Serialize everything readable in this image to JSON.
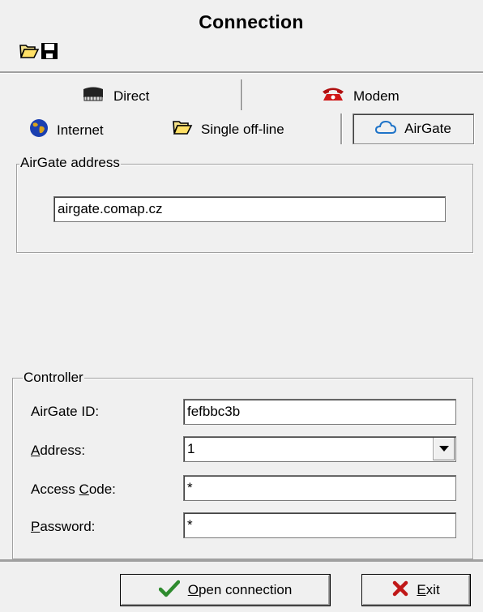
{
  "window": {
    "title": "Connection"
  },
  "toolbar": {
    "open_icon": "folder-open-icon",
    "save_icon": "floppy-save-icon"
  },
  "tabs": {
    "direct": {
      "label": "Direct",
      "icon": "serial-cable-icon"
    },
    "modem": {
      "label": "Modem",
      "icon": "telephone-icon"
    },
    "internet": {
      "label": "Internet",
      "icon": "globe-icon"
    },
    "single_offline": {
      "label": "Single off-line",
      "icon": "folder-open-icon"
    },
    "airgate": {
      "label": "AirGate",
      "icon": "cloud-icon",
      "active": true
    }
  },
  "airgate_group": {
    "legend": "AirGate address",
    "address_value": "airgate.comap.cz"
  },
  "controller_group": {
    "legend": "Controller",
    "airgate_id": {
      "label": "AirGate ID:",
      "value": "fefbbc3b"
    },
    "address": {
      "label_first": "A",
      "label_rest": "ddress:",
      "value": "1"
    },
    "access_code": {
      "label_pre": "Access ",
      "label_u": "C",
      "label_post": "ode:",
      "value": "*"
    },
    "password": {
      "label_first": "P",
      "label_rest": "assword:",
      "value": "*"
    }
  },
  "buttons": {
    "open_connection": {
      "label_first": "O",
      "label_rest": "pen connection",
      "icon": "checkmark-icon",
      "icon_color": "#2e8b2e"
    },
    "exit": {
      "label_first": "E",
      "label_rest": "xit",
      "icon": "red-x-icon",
      "icon_color": "#c01818"
    }
  }
}
